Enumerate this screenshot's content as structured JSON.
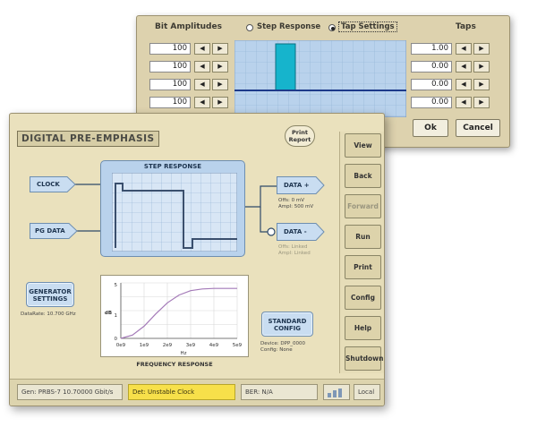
{
  "tap_dialog": {
    "bit_amplitudes_label": "Bit Amplitudes",
    "step_response_label": "Step Response",
    "tap_settings_label": "Tap Settings",
    "taps_label": "Taps",
    "bit_amplitudes": [
      "100",
      "100",
      "100",
      "100"
    ],
    "taps": [
      "1.00",
      "0.00",
      "0.00",
      "0.00"
    ],
    "ok_label": "Ok",
    "cancel_label": "Cancel",
    "arrow_left": "◀",
    "arrow_right": "▶"
  },
  "main": {
    "title": "DIGITAL PRE-EMPHASIS",
    "print_report_line1": "Print",
    "print_report_line2": "Report",
    "clock_label": "CLOCK",
    "pg_data_label": "PG DATA",
    "step_response_title": "STEP RESPONSE",
    "data_plus_label": "DATA +",
    "data_plus_info1": "Offs: 0 mV",
    "data_plus_info2": "Ampl: 500 mV",
    "data_minus_label": "DATA -",
    "data_minus_info1": "Offs: Linked",
    "data_minus_info2": "Ampl: Linked",
    "generator_line1": "GENERATOR",
    "generator_line2": "SETTINGS",
    "data_rate": "DataRate: 10.700 GHz",
    "standard_line1": "STANDARD",
    "standard_line2": "CONFIG",
    "device": "Device: DPP_0000",
    "config": "Config: None",
    "freq_title": "FREQUENCY RESPONSE"
  },
  "side_buttons": [
    "View",
    "Back",
    "Forward",
    "Run",
    "Print",
    "Config",
    "Help",
    "Shutdown"
  ],
  "status_bar": {
    "gen": "Gen: PRBS-7 10.70000 Gbit/s",
    "det": "Det: Unstable Clock",
    "ber": "BER: N/A",
    "local": "Local"
  },
  "chart_data": {
    "type": "line",
    "title": "FREQUENCY RESPONSE",
    "xlabel": "Hz",
    "ylabel": "dB",
    "x_ticks": [
      "0e9",
      "1e9",
      "2e9",
      "3e9",
      "4e9",
      "5e9"
    ],
    "y_ticks": [
      "0",
      "1",
      "5"
    ],
    "x": [
      0,
      0.5,
      1,
      1.5,
      2,
      2.5,
      3,
      3.5,
      4,
      4.5,
      5
    ],
    "y": [
      0,
      0.3,
      1.1,
      2.2,
      3.2,
      3.9,
      4.3,
      4.45,
      4.5,
      4.5,
      4.5
    ],
    "xlim": [
      0,
      5
    ],
    "ylim": [
      0,
      5
    ],
    "grid": true
  },
  "colors": {
    "step_panel": "#b9d2ec",
    "step_trace": "#3a4f6d",
    "tap_bar": "#16b4cc",
    "freq_curve": "#a47ab8",
    "status_warning": "#f7e04a"
  }
}
